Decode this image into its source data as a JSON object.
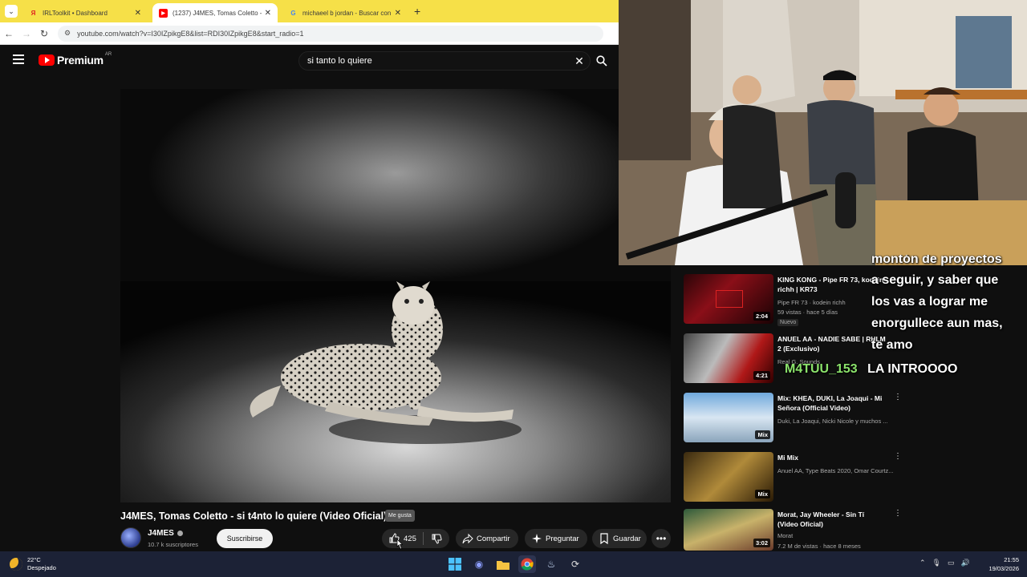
{
  "browser": {
    "tabs": [
      {
        "title": "IRLToolkit • Dashboard",
        "favicon": "yandex-icon"
      },
      {
        "title": "(1237) J4MES, Tomas Coletto - si",
        "favicon": "youtube-icon"
      },
      {
        "title": "michaeel b jordan - Buscar con",
        "favicon": "google-icon"
      }
    ],
    "url": "youtube.com/watch?v=I30IZpikgE8&list=RDI30IZpikgE8&start_radio=1"
  },
  "youtube": {
    "logo_text": "Premium",
    "logo_country": "AR",
    "search_value": "si tanto lo quiere",
    "video": {
      "title": "J4MES, Tomas Coletto - si t4nto lo quiere (Video Oficial)",
      "channel": "J4MES",
      "subscribers": "10.7 k suscriptores",
      "subscribe_label": "Suscribirse",
      "likes": "425",
      "tooltip": "Me gusta",
      "share_label": "Compartir",
      "ask_label": "Preguntar",
      "save_label": "Guardar"
    },
    "recommendations": [
      {
        "title": "KING KONG - Pipe FR 73, kodein richh | KR73",
        "channel": "Pipe FR 73 · kodein richh",
        "meta": "59 vistas · hace 5 días",
        "duration": "2:04",
        "badge": "Nuevo"
      },
      {
        "title": "ANUEL AA - NADIE SABE | RHLM 2 (Exclusivo)",
        "channel": "Real G. Sounds",
        "meta": "",
        "duration": "4:21"
      },
      {
        "title": "Mix: KHEA, DUKI, La Joaqui - Mi Señora (Official Video)",
        "channel": "Duki, La Joaqui, Nicki Nicole y muchos ...",
        "meta": "",
        "duration": "Mix"
      },
      {
        "title": "Mi Mix",
        "channel": "Anuel AA, Type Beats 2020, Omar Courtz...",
        "meta": "",
        "duration": "Mix"
      },
      {
        "title": "Morat, Jay Wheeler - Sin Tí (Video Oficial)",
        "channel": "Morat",
        "meta": "7.2 M de vistas · hace 8 meses",
        "duration": "3:02"
      }
    ]
  },
  "chat": {
    "partial_line": "montón de proyectos",
    "lines": [
      "a seguir, y saber que",
      "los vas a lograr me",
      "enorgullece aun mas,",
      "te amo"
    ],
    "last_user": "M4TUU_153",
    "last_message": "LA INTROOOO"
  },
  "taskbar": {
    "temperature": "22°C",
    "condition": "Despejado",
    "time": "21:55",
    "date": "19/03/2026"
  },
  "colors": {
    "youtube_red": "#ff0000",
    "tabbar_yellow": "#f6e048",
    "chat_user_green": "#8be36b",
    "taskbar": "#1c2236"
  }
}
